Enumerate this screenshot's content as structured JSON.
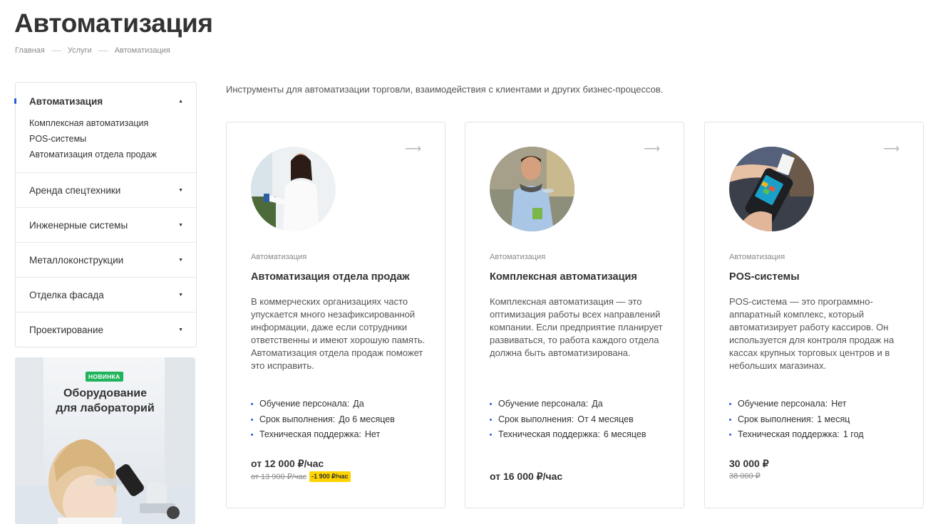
{
  "page": {
    "title": "Автоматизация"
  },
  "breadcrumb": [
    "Главная",
    "Услуги",
    "Автоматизация"
  ],
  "sidebar": {
    "active_section": {
      "label": "Автоматизация",
      "children": [
        "Комплексная автоматизация",
        "POS-системы",
        "Автоматизация отдела продаж"
      ]
    },
    "items": [
      "Аренда спецтехники",
      "Инженерные системы",
      "Металлоконструкции",
      "Отделка фасада",
      "Проектирование"
    ]
  },
  "promo": {
    "badge": "НОВИНКА",
    "title": "Оборудование\nдля лабораторий"
  },
  "intro": "Инструменты для автоматизации торговли, взаимодействия с клиентами и других бизнес-процессов.",
  "cards": [
    {
      "category": "Автоматизация",
      "title": "Автоматизация отдела продаж",
      "description": "В коммерческих организациях часто упускается много незафиксированной информации, даже если сотрудники ответственны и имеют хорошую память. Автоматизация отдела продаж поможет это исправить.",
      "props": [
        {
          "name": "Обучение персонала:",
          "value": "Да"
        },
        {
          "name": "Срок выполнения:",
          "value": "До 6 месяцев"
        },
        {
          "name": "Техническая поддержка:",
          "value": "Нет"
        }
      ],
      "price": "от 12 000 ₽/час",
      "old_price": "от 13 900 ₽/час",
      "economy": "-1 900 ₽/час"
    },
    {
      "category": "Автоматизация",
      "title": "Комплексная автоматизация",
      "description": "Комплексная автоматизация — это оптимизация работы всех направлений компании. Если предприятие планирует развиваться, то работа каждого отдела должна быть автоматизирована.",
      "props": [
        {
          "name": "Обучение персонала:",
          "value": "Да"
        },
        {
          "name": "Срок выполнения:",
          "value": "От 4 месяцев"
        },
        {
          "name": "Техническая поддержка:",
          "value": "6 месяцев"
        }
      ],
      "price": "от 16 000 ₽/час"
    },
    {
      "category": "Автоматизация",
      "title": "POS-системы",
      "description": "POS-система — это программно-аппаратный комплекс, который автоматизирует работу кассиров. Он используется для контроля продаж на кассах крупных торговых центров и в небольших магазинах.",
      "props": [
        {
          "name": "Обучение персонала:",
          "value": "Нет"
        },
        {
          "name": "Срок выполнения:",
          "value": "1 месяц"
        },
        {
          "name": "Техническая поддержка:",
          "value": "1 год"
        }
      ],
      "price": "30 000 ₽",
      "old_price": "38 000 ₽"
    }
  ],
  "icons": {
    "card_arrow": "arrow-right-icon",
    "expand": "caret-icon"
  },
  "colors": {
    "accent": "#2a5bd7",
    "badge_new": "#1fb35c",
    "economy": "#ffd400"
  }
}
